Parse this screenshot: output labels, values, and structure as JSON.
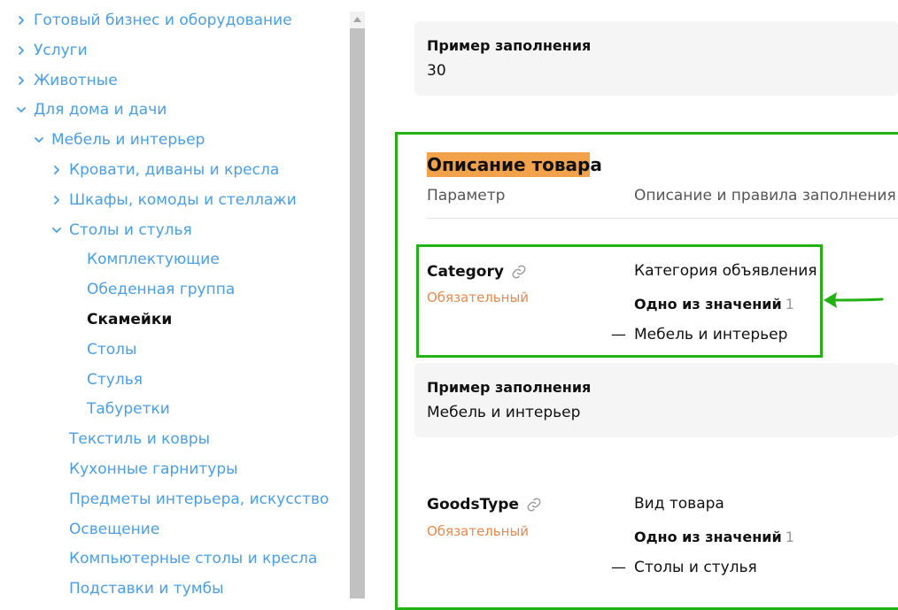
{
  "sidebar": {
    "items": [
      {
        "label": "Готовый бизнес и оборудование",
        "level": 0,
        "expandable": true,
        "expanded": false
      },
      {
        "label": "Услуги",
        "level": 0,
        "expandable": true,
        "expanded": false
      },
      {
        "label": "Животные",
        "level": 0,
        "expandable": true,
        "expanded": false
      },
      {
        "label": "Для дома и дачи",
        "level": 0,
        "expandable": true,
        "expanded": true
      },
      {
        "label": "Мебель и интерьер",
        "level": 1,
        "expandable": true,
        "expanded": true
      },
      {
        "label": "Кровати, диваны и кресла",
        "level": 2,
        "expandable": true,
        "expanded": false
      },
      {
        "label": "Шкафы, комоды и стеллажи",
        "level": 2,
        "expandable": true,
        "expanded": false
      },
      {
        "label": "Столы и стулья",
        "level": 2,
        "expandable": true,
        "expanded": true
      },
      {
        "label": "Комплектующие",
        "level": 3,
        "expandable": false
      },
      {
        "label": "Обеденная группа",
        "level": 3,
        "expandable": false
      },
      {
        "label": "Скамейки",
        "level": 3,
        "expandable": false,
        "active": true
      },
      {
        "label": "Столы",
        "level": 3,
        "expandable": false
      },
      {
        "label": "Стулья",
        "level": 3,
        "expandable": false
      },
      {
        "label": "Табуретки",
        "level": 3,
        "expandable": false
      },
      {
        "label": "Текстиль и ковры",
        "level": 2,
        "expandable": false
      },
      {
        "label": "Кухонные гарнитуры",
        "level": 2,
        "expandable": false
      },
      {
        "label": "Предметы интерьера, искусство",
        "level": 2,
        "expandable": false
      },
      {
        "label": "Освещение",
        "level": 2,
        "expandable": false
      },
      {
        "label": "Компьютерные столы и кресла",
        "level": 2,
        "expandable": false
      },
      {
        "label": "Подставки и тумбы",
        "level": 2,
        "expandable": false
      }
    ]
  },
  "main": {
    "example_top": {
      "title": "Пример заполнения",
      "value": "30"
    },
    "section": {
      "title": "Описание товара",
      "col_param": "Параметр",
      "col_desc": "Описание и правила заполнения"
    },
    "params": [
      {
        "name": "Category",
        "required": "Обязательный",
        "description": "Категория объявления",
        "oneof_label": "Одно из значений",
        "oneof_count": "1",
        "value": "Мебель и интерьер",
        "example_title": "Пример заполнения",
        "example_value": "Мебель и интерьер"
      },
      {
        "name": "GoodsType",
        "required": "Обязательный",
        "description": "Вид товара",
        "oneof_label": "Одно из значений",
        "oneof_count": "1",
        "value": "Столы и стулья"
      }
    ]
  },
  "colors": {
    "link": "#4a9ee6",
    "required": "#e8884a",
    "highlight": "#f2a24a",
    "annotation_green": "#22b214"
  },
  "icons": {
    "chevron": "chevron-icon",
    "link": "link-icon",
    "arrow": "annotation-arrow-icon"
  }
}
